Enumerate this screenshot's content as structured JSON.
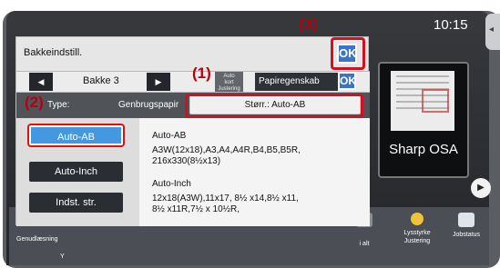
{
  "device": {
    "clock": "10:15",
    "preview_label": "Sharp OSA",
    "next_arrow": "▶",
    "right_handle": "◂",
    "bottom_left_fragment": "Genudlæsning",
    "bottom_left_fragment2": "Y",
    "bottom_items": [
      {
        "label": "i alt"
      },
      {
        "label": "Lysstyrke\nJustering"
      },
      {
        "label": "Jobstatus"
      }
    ]
  },
  "dialog": {
    "title": "Bakkeindstill.",
    "ok_label": "OK",
    "tray_label": "Bakke 3",
    "prev_arrow": "◀",
    "next_arrow": "▶",
    "mid_tab_label": "Auto\nkort Justering",
    "right_tab_label": "Papiregenskab",
    "right_ok_label": "OK",
    "type_label": "Type:",
    "type_value": "Genbrugspapir",
    "size_label": "Størr.: Auto-AB",
    "buttons": [
      {
        "label": "Auto-AB",
        "active": true
      },
      {
        "label": "Auto-Inch",
        "active": false
      },
      {
        "label": "Indst. str.",
        "active": false
      }
    ],
    "info_title_1": "Auto-AB",
    "info_text_1": "A3W(12x18),A3,A4,A4R,B4,B5,B5R,\n216x330(8½x13)",
    "info_title_2": "Auto-Inch",
    "info_text_2": "12x18(A3W),11x17, 8½ x14,8½ x11,\n8½ x11R,7½ x 10½R,"
  },
  "annotations": {
    "callout_1": "(1)",
    "callout_2": "(2)",
    "callout_3": "(3)"
  },
  "colors": {
    "accent_red": "#d50f1f",
    "button_blue": "#4398df",
    "ok_blue": "#3b75c9"
  }
}
